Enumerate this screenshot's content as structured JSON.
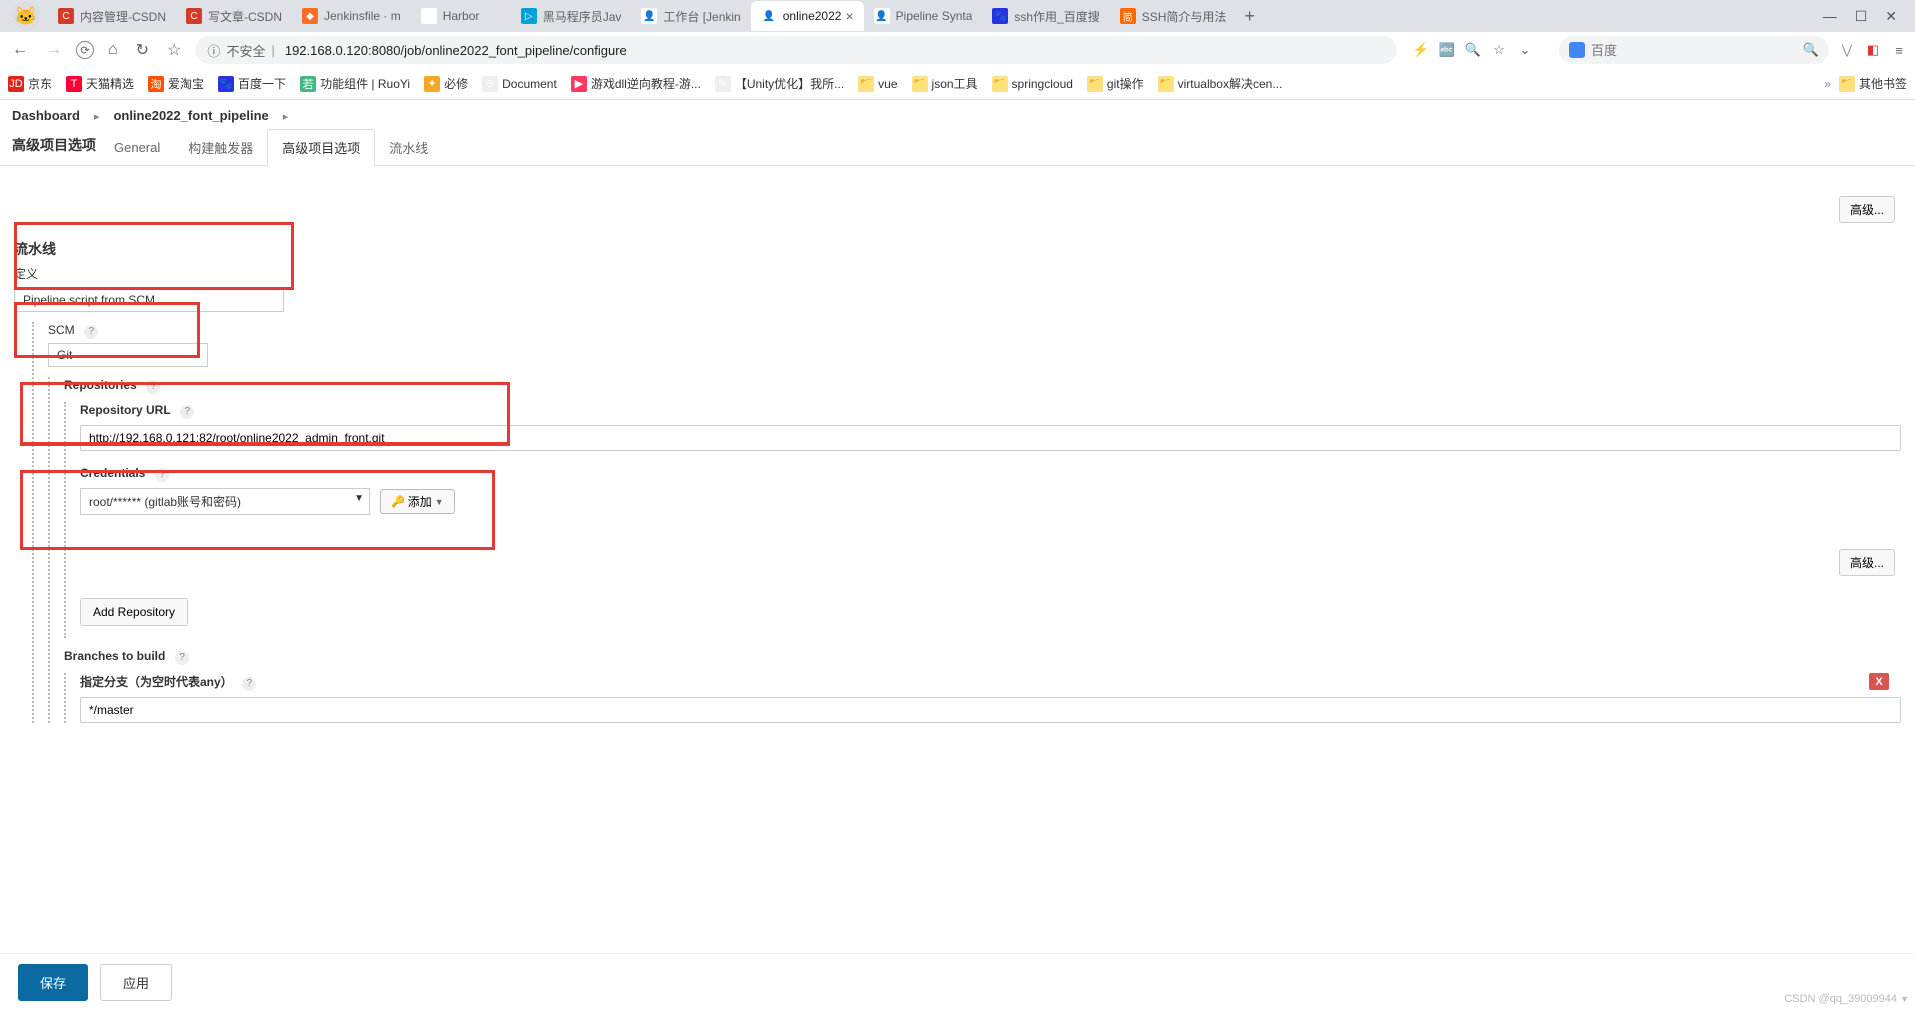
{
  "browser": {
    "tabs": [
      {
        "title": "内容管理-CSDN",
        "icon_bg": "#d43b2a",
        "icon_txt": "C"
      },
      {
        "title": "写文章-CSDN",
        "icon_bg": "#d43b2a",
        "icon_txt": "C"
      },
      {
        "title": "Jenkinsfile · m",
        "icon_bg": "#fc6d26",
        "icon_txt": "◆"
      },
      {
        "title": "Harbor",
        "icon_bg": "#fff",
        "icon_txt": "⊚"
      },
      {
        "title": "黑马程序员Jav",
        "icon_bg": "#00a1d6",
        "icon_txt": "▷"
      },
      {
        "title": "工作台 [Jenkin",
        "icon_bg": "#fff",
        "icon_txt": "👤"
      },
      {
        "title": "online2022",
        "icon_bg": "#fff",
        "icon_txt": "👤",
        "active": true
      },
      {
        "title": "Pipeline Synta",
        "icon_bg": "#fff",
        "icon_txt": "👤"
      },
      {
        "title": "ssh作用_百度搜",
        "icon_bg": "#2932e1",
        "icon_txt": "🐾"
      },
      {
        "title": "SSH简介与用法",
        "icon_bg": "#ff6a00",
        "icon_txt": "简"
      }
    ],
    "address": {
      "insecure_label": "不安全",
      "url": "192.168.0.120:8080/job/online2022_font_pipeline/configure"
    },
    "search_placeholder": "百度",
    "bookmarks": [
      {
        "label": "京东",
        "bg": "#e1251b",
        "txt": "JD"
      },
      {
        "label": "天猫精选",
        "bg": "#ff0036",
        "txt": "T"
      },
      {
        "label": "爱淘宝",
        "bg": "#ff5000",
        "txt": "淘"
      },
      {
        "label": "百度一下",
        "bg": "#2932e1",
        "txt": "🐾"
      },
      {
        "label": "功能组件 | RuoYi",
        "bg": "#42b883",
        "txt": "若"
      },
      {
        "label": "必修",
        "bg": "#f5a623",
        "txt": "✦"
      },
      {
        "label": "Document",
        "bg": "#eee",
        "txt": "⊚"
      },
      {
        "label": "游戏dll逆向教程-游...",
        "bg": "#ff3860",
        "txt": "▶"
      },
      {
        "label": "【Unity优化】我所...",
        "bg": "#eee",
        "txt": "✎"
      },
      {
        "label": "vue",
        "bg": "#ffe082",
        "txt": "📁"
      },
      {
        "label": "json工具",
        "bg": "#ffe082",
        "txt": "📁"
      },
      {
        "label": "springcloud",
        "bg": "#ffe082",
        "txt": "📁"
      },
      {
        "label": "git操作",
        "bg": "#ffe082",
        "txt": "📁"
      },
      {
        "label": "virtualbox解决cen...",
        "bg": "#ffe082",
        "txt": "📁"
      }
    ],
    "other_bookmarks": "其他书签"
  },
  "page": {
    "breadcrumb": {
      "dashboard": "Dashboard",
      "job": "online2022_font_pipeline"
    },
    "left_label": "高级项目选项",
    "tabs": {
      "general": "General",
      "triggers": "构建触发器",
      "advanced": "高级项目选项",
      "pipeline": "流水线"
    },
    "advanced_btn": "高级...",
    "pipeline_section": "流水线",
    "definition_label": "定义",
    "definition_value": "Pipeline script from SCM",
    "scm_label": "SCM",
    "scm_value": "Git",
    "repositories_label": "Repositories",
    "repo_url_label": "Repository URL",
    "repo_url_value": "http://192.168.0.121:82/root/online2022_admin_front.git",
    "credentials_label": "Credentials",
    "credentials_value": "root/****** (gitlab账号和密码)",
    "add_cred_label": "添加",
    "add_repo_label": "Add Repository",
    "branches_label": "Branches to build",
    "branch_spec_label": "指定分支（为空时代表any）",
    "branch_spec_value": "*/master",
    "delete_x": "X",
    "save": "保存",
    "apply": "应用"
  },
  "watermark": "CSDN @qq_39009944"
}
